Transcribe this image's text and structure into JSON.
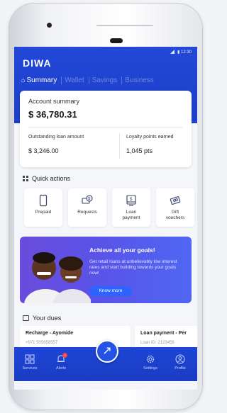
{
  "status": {
    "time": "12:30"
  },
  "app": {
    "brand": "DIWA"
  },
  "tabs": [
    {
      "label": "Summary",
      "active": true
    },
    {
      "label": "Wallet",
      "active": false
    },
    {
      "label": "Savings",
      "active": false
    },
    {
      "label": "Business",
      "active": false
    }
  ],
  "account": {
    "title": "Account summary",
    "balance": "$ 36,780.31",
    "outstanding_label": "Outstanding loan amount",
    "outstanding_value": "$ 3,246.00",
    "loyalty_label": "Loyalty points earned",
    "loyalty_value": "1,045 pts"
  },
  "quick_actions": {
    "title": "Quick actions",
    "items": [
      {
        "label": "Prepaid",
        "icon": "phone-icon"
      },
      {
        "label": "Requests",
        "icon": "money-request-icon"
      },
      {
        "label": "Loan payment",
        "icon": "loan-payment-icon"
      },
      {
        "label": "Gift vouchers",
        "icon": "gift-voucher-icon"
      }
    ]
  },
  "banner": {
    "title": "Achieve all your goals!",
    "body": "Get retail loans at unbelievably low interest rates and start building towards your goals now!",
    "button": "Know more"
  },
  "dues": {
    "title": "Your dues",
    "items": [
      {
        "title": "Recharge - Ayomide",
        "subtitle": "+971 505658557"
      },
      {
        "title": "Loan payment - Per",
        "subtitle": "Loan ID: 2123456"
      }
    ]
  },
  "nav": {
    "items": [
      {
        "label": "Services",
        "icon": "services-grid-icon"
      },
      {
        "label": "Alerts",
        "icon": "bell-icon",
        "badge": "2"
      },
      {
        "label": "Settings",
        "icon": "gear-icon"
      },
      {
        "label": "Profile",
        "icon": "profile-icon"
      }
    ],
    "fab_icon": "arrow-up-right-icon"
  },
  "colors": {
    "primary": "#1f44d3",
    "banner": "#5a53e8",
    "badge": "#ff3b3b"
  }
}
